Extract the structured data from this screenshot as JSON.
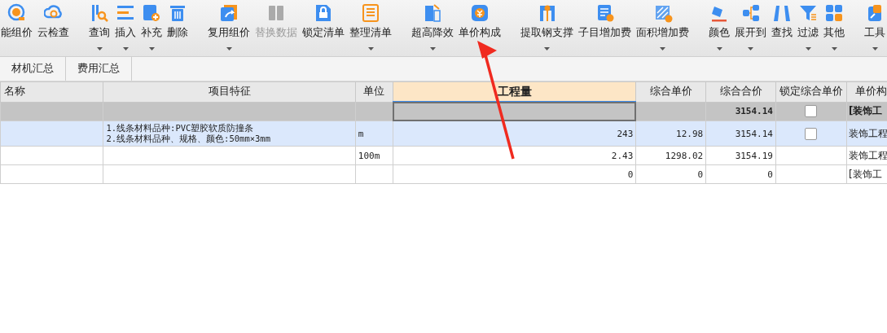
{
  "toolbar": {
    "groups": [
      [
        {
          "label": "能组价",
          "dropdown": false,
          "disabled": false
        },
        {
          "label": "云检查",
          "dropdown": false,
          "disabled": false
        }
      ],
      [
        {
          "label": "查询",
          "dropdown": true,
          "disabled": false
        },
        {
          "label": "插入",
          "dropdown": true,
          "disabled": false
        },
        {
          "label": "补充",
          "dropdown": true,
          "disabled": false
        },
        {
          "label": "删除",
          "dropdown": false,
          "disabled": false
        }
      ],
      [
        {
          "label": "复用组价",
          "dropdown": true,
          "disabled": false
        },
        {
          "label": "替换数据",
          "dropdown": false,
          "disabled": true
        },
        {
          "label": "锁定清单",
          "dropdown": false,
          "disabled": false
        },
        {
          "label": "整理清单",
          "dropdown": true,
          "disabled": false
        }
      ],
      [
        {
          "label": "超高降效",
          "dropdown": true,
          "disabled": false
        },
        {
          "label": "单价构成",
          "dropdown": false,
          "disabled": false
        }
      ],
      [
        {
          "label": "提取钢支撑",
          "dropdown": true,
          "disabled": false
        },
        {
          "label": "子目增加费",
          "dropdown": false,
          "disabled": false
        },
        {
          "label": "面积增加费",
          "dropdown": true,
          "disabled": false
        }
      ],
      [
        {
          "label": "颜色",
          "dropdown": true,
          "disabled": false
        },
        {
          "label": "展开到",
          "dropdown": true,
          "disabled": false
        },
        {
          "label": "查找",
          "dropdown": false,
          "disabled": false
        },
        {
          "label": "过滤",
          "dropdown": true,
          "disabled": false
        },
        {
          "label": "其他",
          "dropdown": true,
          "disabled": false
        }
      ],
      [
        {
          "label": "工具",
          "dropdown": true,
          "disabled": false
        }
      ]
    ]
  },
  "tabs": [
    {
      "label": "材机汇总",
      "selected": false
    },
    {
      "label": "费用汇总",
      "selected": false
    }
  ],
  "table": {
    "columns": [
      {
        "label": "名称",
        "selected": false
      },
      {
        "label": "项目特征",
        "selected": false
      },
      {
        "label": "单位",
        "selected": false
      },
      {
        "label": "工程量",
        "selected": true
      },
      {
        "label": "综合单价",
        "selected": false
      },
      {
        "label": "综合合价",
        "selected": false
      },
      {
        "label": "锁定综合单价",
        "selected": false
      },
      {
        "label": "单价构",
        "selected": false
      }
    ],
    "rows": [
      {
        "kind": "section",
        "selected": false,
        "focused": true,
        "locked": false,
        "cells": {
          "total_price": "3154.14",
          "column_8": "[装饰工"
        }
      },
      {
        "kind": "item",
        "selected": true,
        "focused": false,
        "locked": false,
        "cells": {
          "feature": "1.线条材料品种:PVC塑胶软质防撞条\n2.线条材料品种、规格、颜色:50mm×3mm",
          "unit": "m",
          "quantity": "243",
          "unit_price": "12.98",
          "total_price": "3154.14",
          "column_8": "装饰工程"
        }
      },
      {
        "kind": "item",
        "selected": false,
        "focused": false,
        "cells": {
          "unit": "100m",
          "quantity": "2.43",
          "unit_price": "1298.02",
          "total_price": "3154.19",
          "column_8": "装饰工程"
        }
      },
      {
        "kind": "item",
        "selected": false,
        "focused": false,
        "cells": {
          "quantity": "0",
          "unit_price": "0",
          "total_price": "0",
          "column_8": "[装饰工"
        }
      }
    ]
  }
}
